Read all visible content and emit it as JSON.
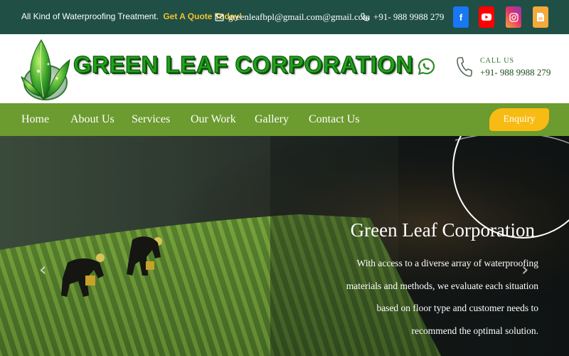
{
  "topbar": {
    "tagline": "All Kind of Waterproofing Treatment.",
    "quote_link": "Get A Quote Today!",
    "email": "greenleafbpl@gmail.com@gmail.com",
    "phone": "+91-  988  9988  279",
    "icons": [
      "email-icon",
      "phone-icon",
      "facebook-icon",
      "youtube-icon",
      "instagram-icon",
      "skype-icon"
    ]
  },
  "header": {
    "brand": "GREEN LEAF CORPORATION",
    "call_label": "CALL US",
    "call_number": "+91- 988 9988 279"
  },
  "nav": {
    "items": [
      "Home",
      "About Us",
      "Services",
      "Our Work",
      "Gallery",
      "Contact Us"
    ],
    "enquiry": "Enquiry"
  },
  "hero": {
    "title": "Green Leaf  Corporation",
    "lines": [
      "With access to a diverse array of waterproofing",
      "materials and methods, we evaluate each situation",
      "based on floor type and customer needs to",
      "recommend the optimal solution."
    ],
    "prev": "‹",
    "next": "›"
  },
  "colors": {
    "topbar": "#1f4f45",
    "nav": "#6c9b2f",
    "accent": "#f7bb13",
    "brand_green": "#22a11e"
  }
}
